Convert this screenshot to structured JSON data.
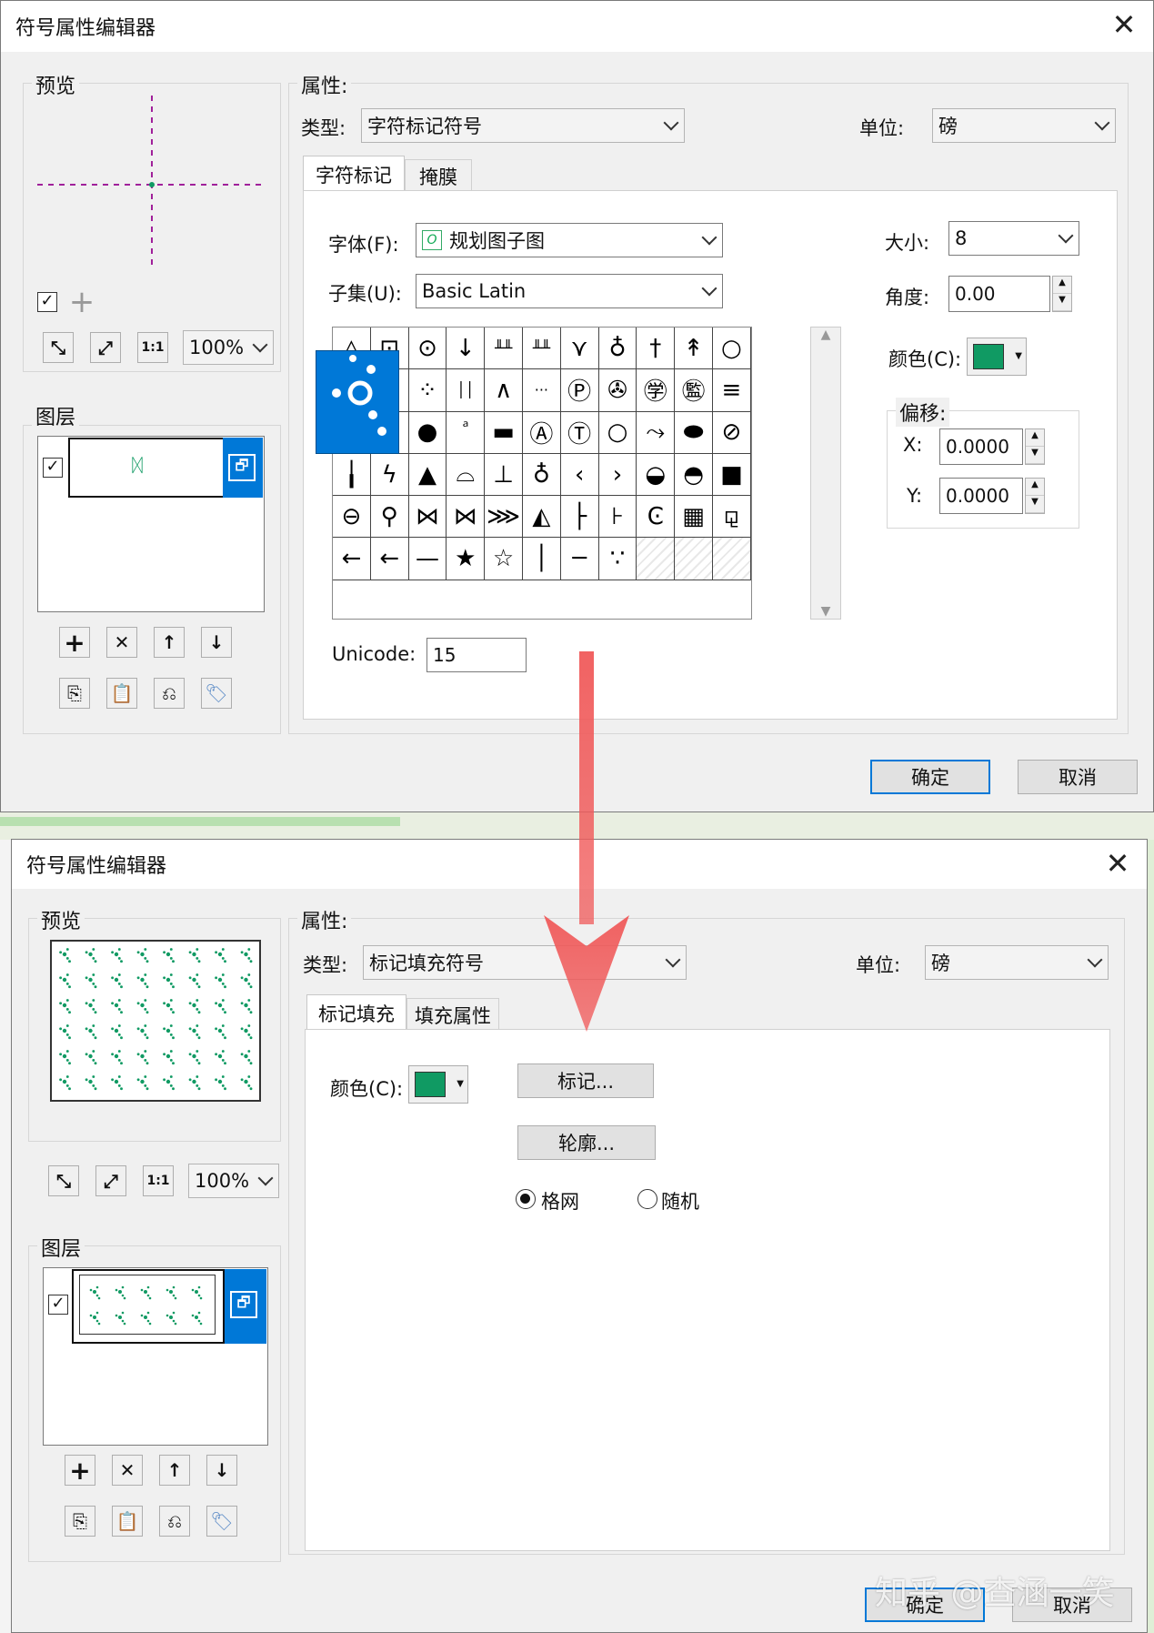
{
  "dialog1": {
    "title": "符号属性编辑器",
    "preview_label": "预览",
    "layers_label": "图层",
    "properties_label": "属性:",
    "type_label": "类型:",
    "type_value": "字符标记符号",
    "unit_label": "单位:",
    "unit_value": "磅",
    "tabs": [
      "字符标记",
      "掩膜"
    ],
    "font_label": "字体(F):",
    "font_value": "规划图子图",
    "subset_label": "子集(U):",
    "subset_value": "Basic Latin",
    "size_label": "大小:",
    "size_value": "8",
    "angle_label": "角度:",
    "angle_value": "0.00",
    "color_label": "颜色(C):",
    "offset_label": "偏移:",
    "x_label": "X:",
    "x_value": "0.0000",
    "y_label": "Y:",
    "y_value": "0.0000",
    "unicode_label": "Unicode:",
    "unicode_value": "15",
    "zoom_value": "100%",
    "ok_label": "确定",
    "cancel_label": "取消",
    "glyphs": [
      [
        "△",
        "⊡",
        "⊙",
        "↓",
        "╨╨",
        "╨╨",
        "⋎",
        "♁",
        "†",
        "↟",
        "○"
      ],
      [
        "",
        "∴",
        "⁘",
        "││",
        "∧",
        "···",
        "Ⓟ",
        "✇",
        "㊫",
        "㊬",
        "≡"
      ],
      [
        "⊕",
        "●",
        "●",
        "ⷶ",
        "▬",
        "Ⓐ",
        "Ⓣ",
        "○",
        "⤳",
        "⬬",
        "⊘"
      ],
      [
        "╽",
        "ϟ",
        "▲",
        "⌓",
        "⊥",
        "♁",
        "‹",
        "›",
        "◒",
        "◓",
        "■"
      ],
      [
        "⊖",
        "⚲",
        "⋈",
        "⋈",
        "⋙",
        "◭",
        "├",
        "⊦",
        "Ͼ",
        "▦",
        "⚼"
      ],
      [
        "←",
        "←",
        "—",
        "★",
        "☆",
        "│",
        "─",
        "∵",
        "",
        "",
        ""
      ]
    ]
  },
  "dialog2": {
    "title": "符号属性编辑器",
    "preview_label": "预览",
    "layers_label": "图层",
    "properties_label": "属性:",
    "type_label": "类型:",
    "type_value": "标记填充符号",
    "unit_label": "单位:",
    "unit_value": "磅",
    "tabs": [
      "标记填充",
      "填充属性"
    ],
    "color_label": "颜色(C):",
    "marker_button": "标记...",
    "outline_button": "轮廓...",
    "radio_grid": "格网",
    "radio_random": "随机",
    "zoom_value": "100%",
    "ok_label": "确定",
    "cancel_label": "取消"
  },
  "watermark": "知乎 @查涵一笑",
  "colors": {
    "fill_green": "#109a63",
    "selected_blue": "#0078d7",
    "arrow_red": "#f05a5a"
  }
}
